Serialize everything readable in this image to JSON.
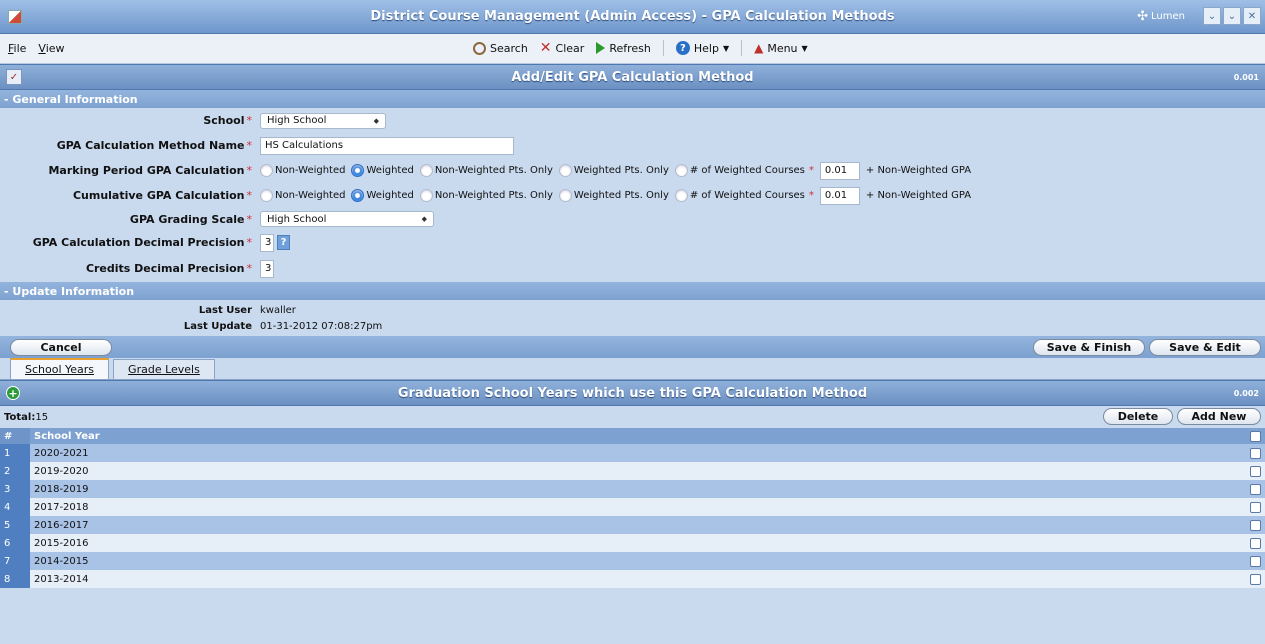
{
  "window": {
    "title": "District Course Management (Admin Access) - GPA Calculation Methods",
    "brand": "Lumen"
  },
  "menu": {
    "file": "File",
    "view": "View"
  },
  "toolbar": {
    "search": "Search",
    "clear": "Clear",
    "refresh": "Refresh",
    "help": "Help",
    "menu": "Menu"
  },
  "form": {
    "title": "Add/Edit GPA Calculation Method",
    "code": "0.001",
    "general_label": "- General Information",
    "fields": {
      "school_label": "School",
      "school_value": "High School",
      "method_name_label": "GPA Calculation Method Name",
      "method_name_value": "HS Calculations",
      "mp_label": "Marking Period GPA Calculation",
      "cum_label": "Cumulative GPA Calculation",
      "grading_scale_label": "GPA Grading Scale",
      "grading_scale_value": "High School",
      "decimal_label": "GPA Calculation Decimal Precision",
      "decimal_value": "3",
      "credits_label": "Credits Decimal Precision",
      "credits_value": "3"
    },
    "options": {
      "non_weighted": "Non-Weighted",
      "weighted": "Weighted",
      "nw_pts": "Non-Weighted Pts. Only",
      "w_pts": "Weighted Pts. Only",
      "num_weighted": "# of Weighted Courses",
      "plus_nw": "+ Non-Weighted GPA",
      "mp_weighted_value": "0.01",
      "cum_weighted_value": "0.01"
    },
    "update_label": "- Update Information",
    "last_user_label": "Last User",
    "last_user_value": "kwaller",
    "last_update_label": "Last Update",
    "last_update_value": "01-31-2012 07:08:27pm"
  },
  "buttons": {
    "cancel": "Cancel",
    "save_finish": "Save & Finish",
    "save_edit": "Save & Edit",
    "delete": "Delete",
    "add_new": "Add New"
  },
  "tabs": {
    "school_years": "School Years",
    "grade_levels": "Grade Levels"
  },
  "grid": {
    "title": "Graduation School Years which use this GPA Calculation Method",
    "code": "0.002",
    "total_label": "Total:",
    "total_value": "15",
    "col_num": "#",
    "col_year": "School Year",
    "rows": [
      {
        "n": "1",
        "year": "2020-2021"
      },
      {
        "n": "2",
        "year": "2019-2020"
      },
      {
        "n": "3",
        "year": "2018-2019"
      },
      {
        "n": "4",
        "year": "2017-2018"
      },
      {
        "n": "5",
        "year": "2016-2017"
      },
      {
        "n": "6",
        "year": "2015-2016"
      },
      {
        "n": "7",
        "year": "2014-2015"
      },
      {
        "n": "8",
        "year": "2013-2014"
      }
    ]
  },
  "icons": {
    "app": "app-icon",
    "spell": "spellcheck-icon",
    "add": "add-icon"
  }
}
